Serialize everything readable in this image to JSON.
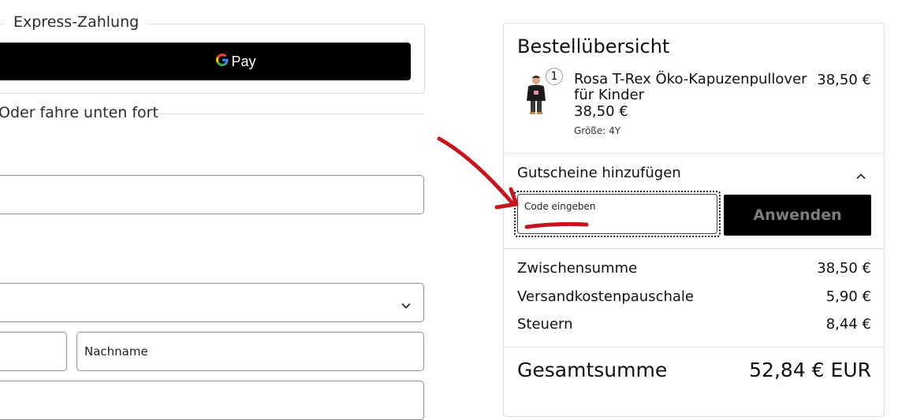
{
  "express": {
    "legend": "Express-Zahlung",
    "gpay_label": "Pay"
  },
  "divider_text": "Oder fahre unten fort",
  "form": {
    "last_name_placeholder": "Nachname"
  },
  "summary": {
    "title": "Bestellübersicht",
    "item": {
      "quantity": "1",
      "name": "Rosa T-Rex Öko-Kapuzenpullover für Kinder",
      "price": "38,50 €",
      "unit_price": "38,50 €",
      "size": "Größe: 4Y"
    },
    "coupon": {
      "title": "Gutscheine hinzufügen",
      "placeholder": "Code eingeben",
      "apply_label": "Anwenden"
    },
    "rows": [
      {
        "label": "Zwischensumme",
        "value": "38,50 €"
      },
      {
        "label": "Versandkostenpauschale",
        "value": "5,90 €"
      },
      {
        "label": "Steuern",
        "value": "8,44 €"
      }
    ],
    "total": {
      "label": "Gesamtsumme",
      "value": "52,84 € EUR"
    }
  },
  "colors": {
    "annotation_red": "#c4161c",
    "button_black": "#000000"
  }
}
